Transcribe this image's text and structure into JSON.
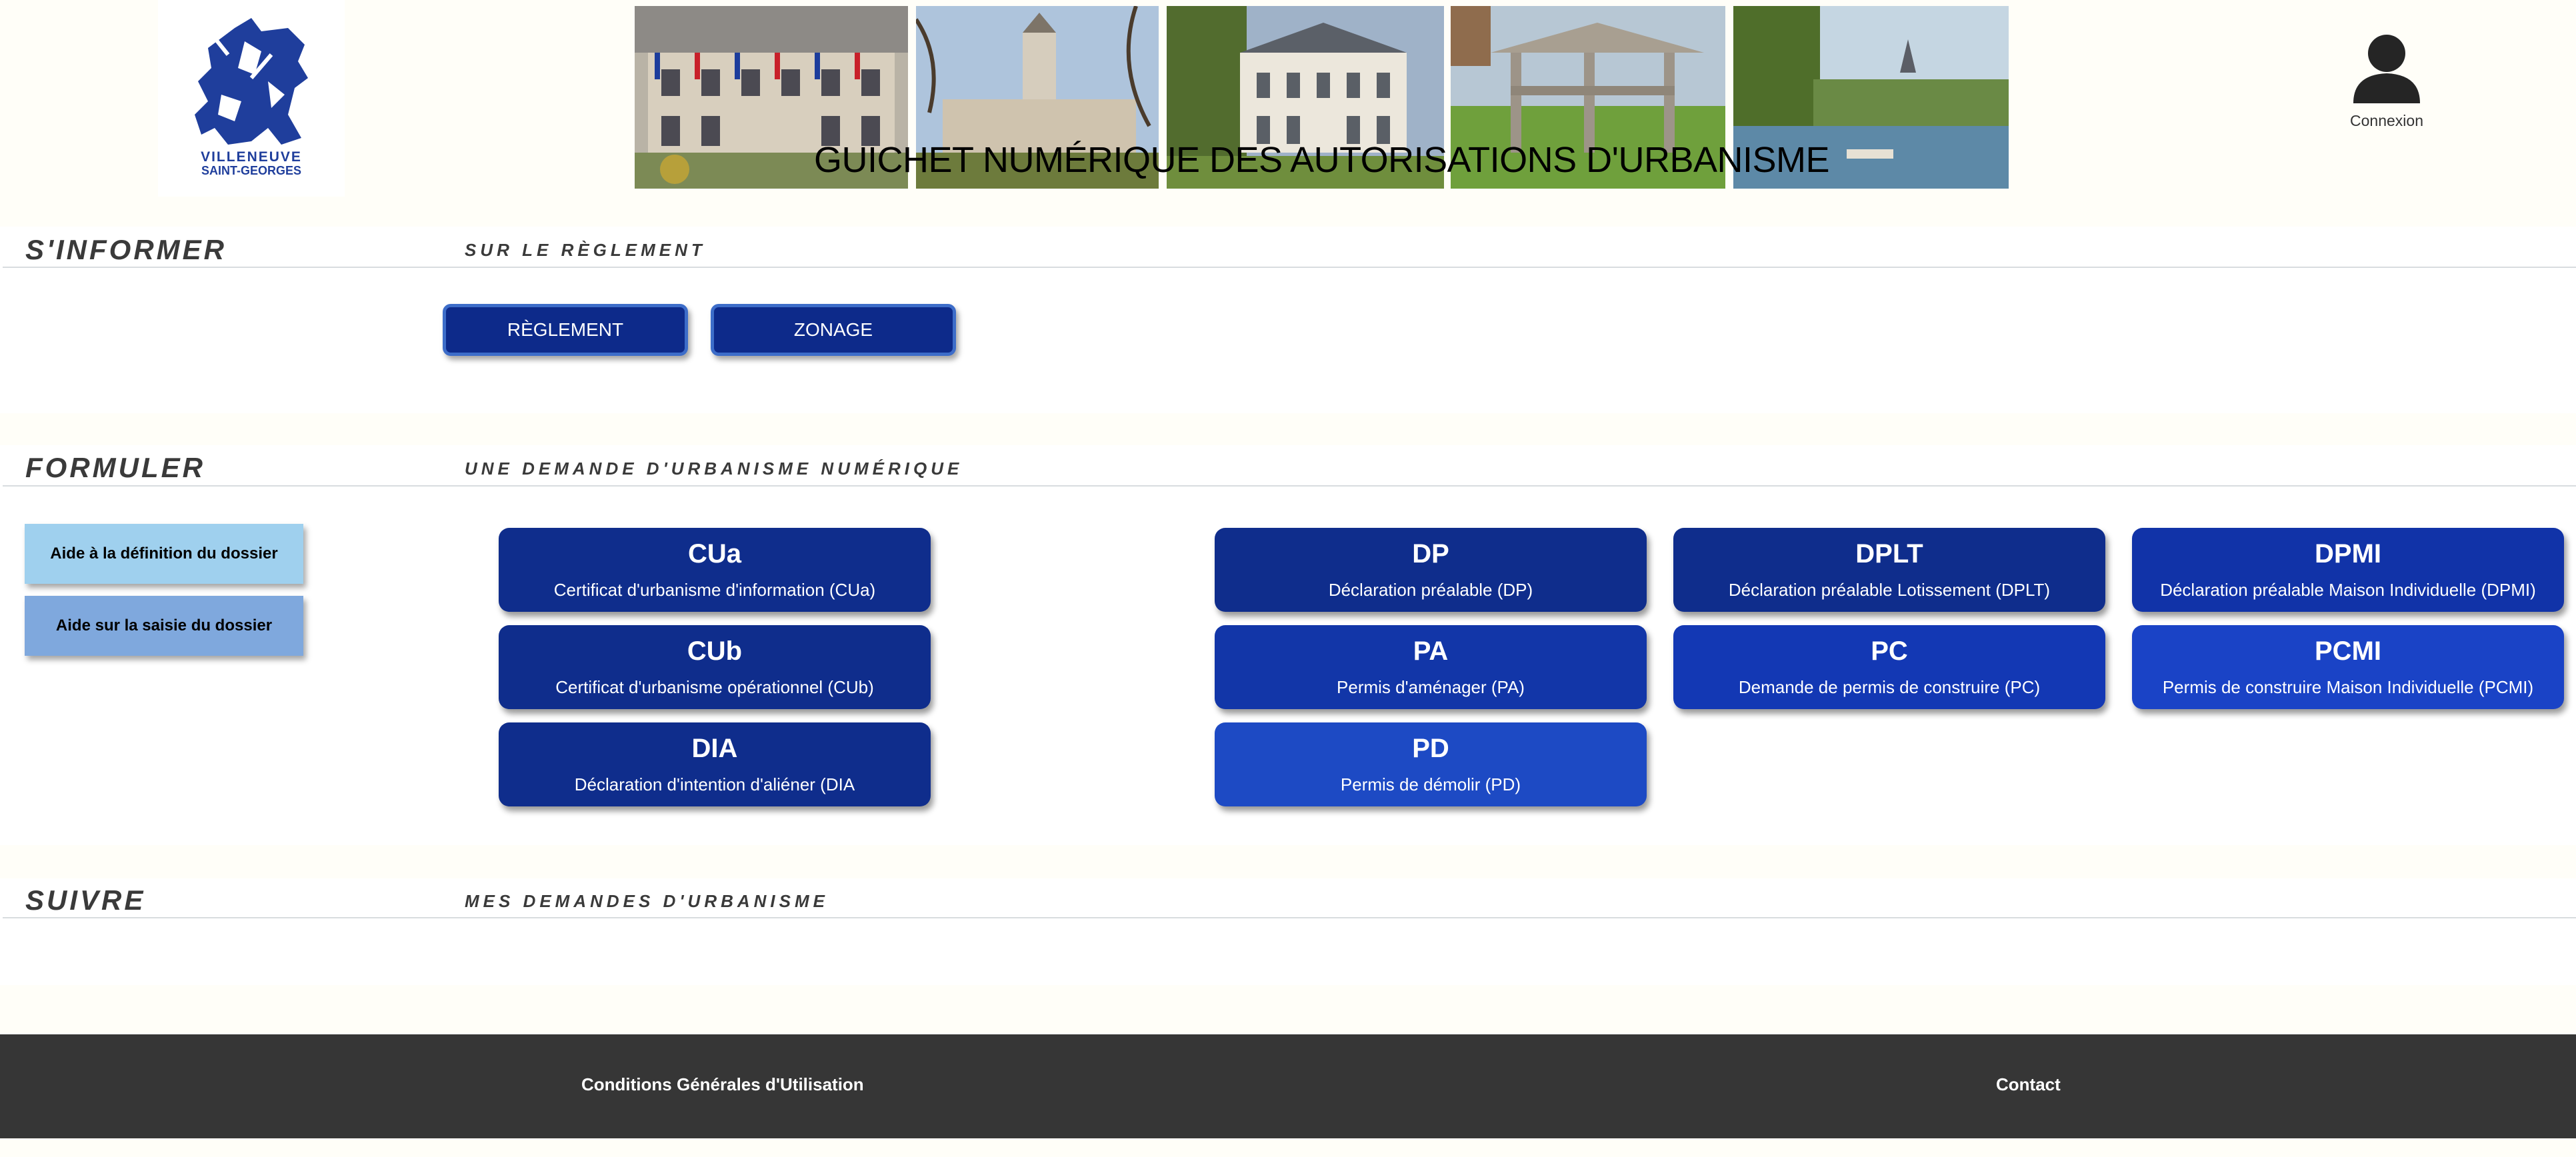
{
  "header": {
    "logo": {
      "line1": "VILLENEUVE",
      "line2": "SAINT-GEORGES",
      "color": "#1f3e9c"
    },
    "banner_title": "GUICHET NUMÉRIQUE DES AUTORISATIONS D'URBANISME",
    "user": {
      "icon": "user-icon",
      "label": "Connexion"
    }
  },
  "sections": {
    "informer": {
      "title": "S'INFORMER",
      "subtitle": "SUR LE RÈGLEMENT",
      "buttons": [
        {
          "label": "RÈGLEMENT"
        },
        {
          "label": "ZONAGE"
        }
      ]
    },
    "formuler": {
      "title": "FORMULER",
      "subtitle": "UNE DEMANDE D'URBANISME NUMÉRIQUE",
      "help_buttons": [
        {
          "label": "Aide à la définition du dossier",
          "color": "#9fd0ee"
        },
        {
          "label": "Aide sur la saisie du dossier",
          "color": "#7fa8dd"
        }
      ],
      "demands": [
        {
          "code": "CUa",
          "label": "Certificat d'urbanisme d'information (CUa)",
          "color": "#0f2d8c"
        },
        {
          "code": "CUb",
          "label": "Certificat d'urbanisme opérationnel (CUb)",
          "color": "#0f2d8c"
        },
        {
          "code": "DIA",
          "label": "Déclaration d'intention d'aliéner (DIA",
          "color": "#0f2d8c"
        },
        {
          "code": "DP",
          "label": "Déclaration préalable (DP)",
          "color": "#0f2d8c"
        },
        {
          "code": "PA",
          "label": "Permis d'aménager (PA)",
          "color": "#1236a8"
        },
        {
          "code": "PD",
          "label": "Permis de démolir (PD)",
          "color": "#1d4ac4"
        },
        {
          "code": "DPLT",
          "label": "Déclaration préalable Lotissement (DPLT)",
          "color": "#0f2d8c"
        },
        {
          "code": "PC",
          "label": "Demande de permis de construire (PC)",
          "color": "#1338b4"
        },
        {
          "code": "DPMI",
          "label": "Déclaration préalable Maison Individuelle (DPMI)",
          "color": "#1133a8"
        },
        {
          "code": "PCMI",
          "label": "Permis de construire Maison Individuelle (PCMI)",
          "color": "#1a43c6"
        }
      ]
    },
    "suivre": {
      "title": "SUIVRE",
      "subtitle": "MES DEMANDES D'URBANISME"
    }
  },
  "footer": {
    "cgu": "Conditions Générales d'Utilisation",
    "contact": "Contact"
  }
}
